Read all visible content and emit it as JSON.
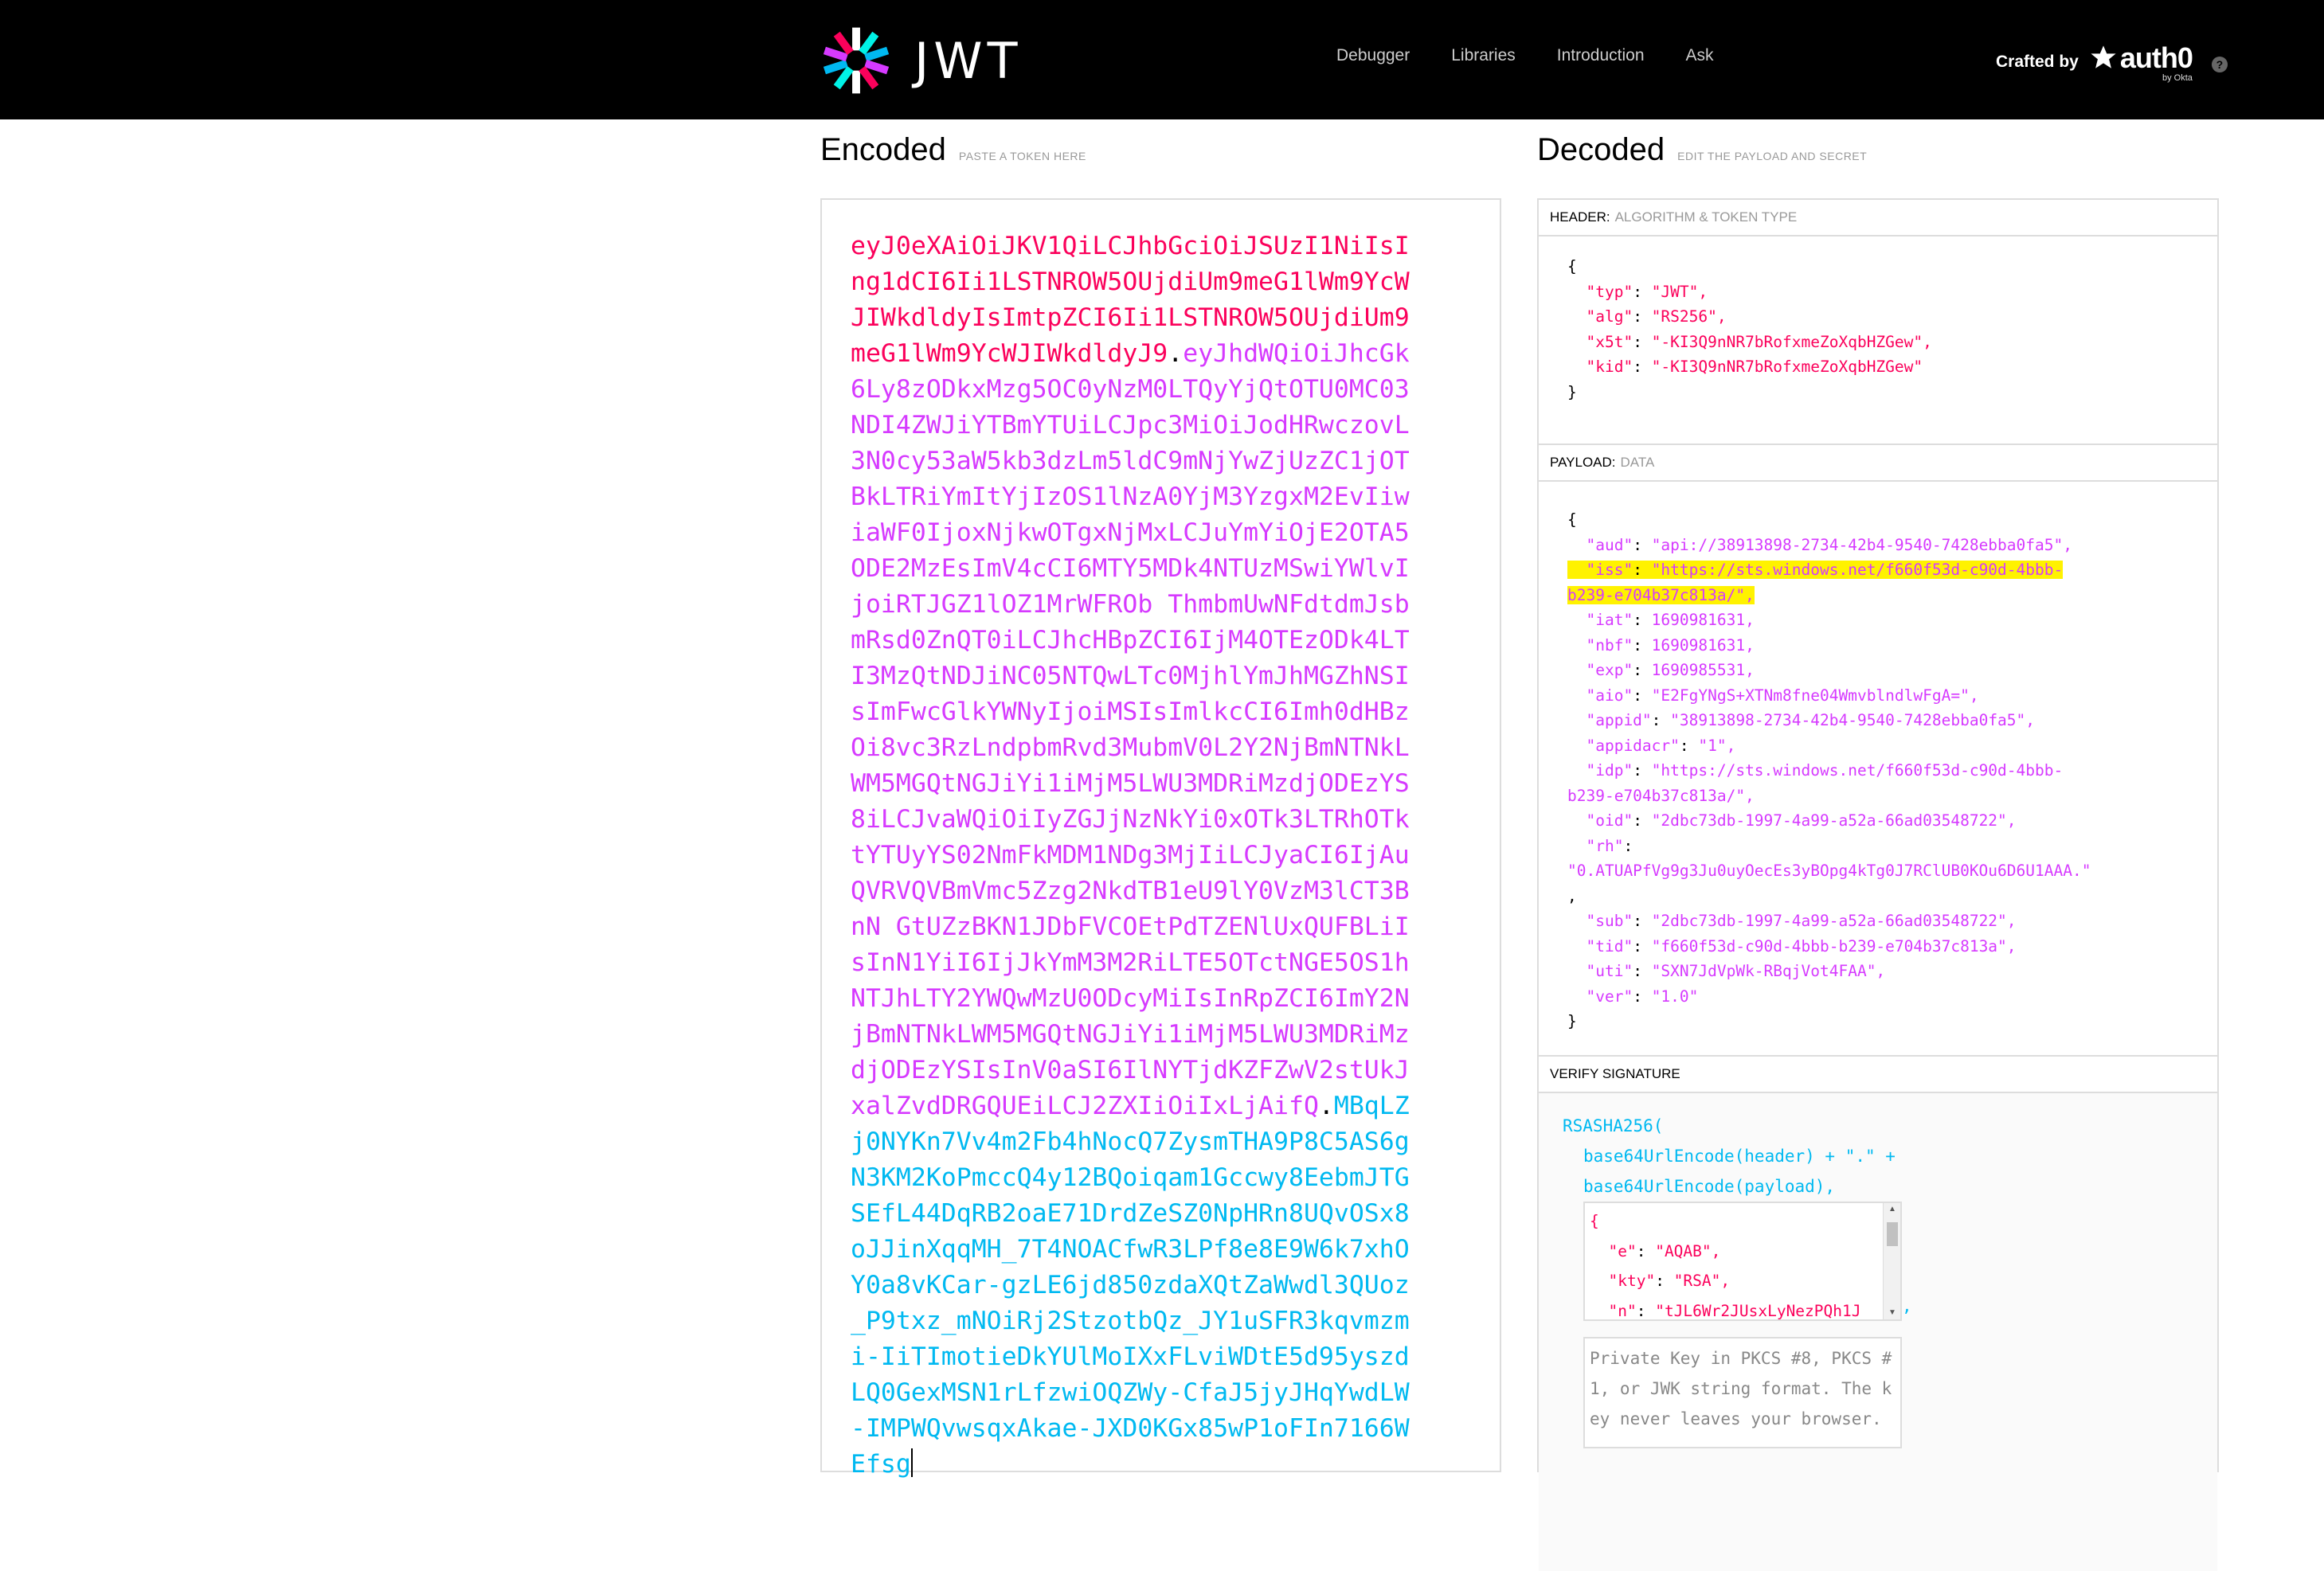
{
  "header": {
    "logo_text": "JWT",
    "nav": [
      "Debugger",
      "Libraries",
      "Introduction",
      "Ask"
    ],
    "crafted_by": "Crafted by",
    "auth0_name": "auth0",
    "auth0_by": "by Okta",
    "help": "?"
  },
  "encoded": {
    "title": "Encoded",
    "hint": "PASTE A TOKEN HERE",
    "token_header": "eyJ0eXAiOiJKV1QiLCJhbGciOiJSUzI1NiIsIng1dCI6Ii1LSTNROW5OUjdiUm9meG1lWm9YcWJIWkdldyIsImtpZCI6Ii1LSTNROW5OUjdiUm9meG1lWm9YcWJIWkdldyJ9",
    "token_payload": "eyJhdWQiOiJhcGk6Ly8zODkxMzg5OC0yNzM0LTQyYjQtOTU0MC03NDI4ZWJiYTBmYTUiLCJpc3MiOiJodHRwczovL3N0cy53aW5kb3dzLm5ldC9mNjYwZjUzZC1jOTBkLTRiYmItYjIzOS1lNzA0YjM3YzgxM2EvIiwiaWF0IjoxNjkwOTgxNjMxLCJuYmYiOjE2OTA5ODE2MzEsImV4cCI6MTY5MDk4NTUzMSwiYWlvIjoiRTJGZ1lOZ1MrWFROb ThmbmUwNFdtdmJsbmRsd0ZnQT0iLCJhcHBpZCI6IjM4OTEzODk4LTI3MzQtNDJiNC05NTQwLTc0MjhlYmJhMGZhNSIsImFwcGlkYWNyIjoiMSIsImlkcCI6Imh0dHBzOi8vc3RzLndpbmRvd3MubmV0L2Y2NjBmNTNkLWM5MGQtNGJiYi1iMjM5LWU3MDRiMzdjODEzYS8iLCJvaWQiOiIyZGJjNzNkYi0xOTk3LTRhOTktYTUyYS02NmFkMDM1NDg3MjIiLCJyaCI6IjAuQVRVQVBmVmc5Zzg2NkdTB1eU9lY0VzM3lCT3BnN GtUZzBKN1JDbFVCOEtPdTZENlUxQUFBLiIsInN1YiI6IjJkYmM3M2RiLTE5OTctNGE5OS1hNTJhLTY2YWQwMzU0ODcyMiIsInRpZCI6ImY2NjBmNTNkLWM5MGQtNGJiYi1iMjM5LWU3MDRiMzdjODEzYSIsInV0aSI6IlNYTjdKZFZwV2stUkJxalZvdDRGQUEiLCJ2ZXIiOiIxLjAifQ",
    "token_signature": "MBqLZj0NYKn7Vv4m2Fb4hNocQ7ZysmTHA9P8C5AS6gN3KM2KoPmccQ4y12BQoiqam1Gccwy8EebmJTGSEfL44DqRB2oaE71DrdZeSZ0NpHRn8UQvOSx8oJJinXqqMH_7T4NOACfwR3LPf8e8E9W6k7xhOY0a8vKCar-gzLE6jd850zdaXQtZaWwdl3QUoz_P9txz_mNOiRj2StzotbQz_JY1uSFR3kqvmzmi-IiTImotieDkYUlMoIXxFLviWDtE5d95yszdLQ0GexMSN1rLfzwiOQZWy-CfaJ5jyJHqYwdLW-IMPWQvwsqxAkae-JXD0KGx85wP1oFIn7166WEfsg",
    "dot": "."
  },
  "decoded": {
    "title": "Decoded",
    "hint": "EDIT THE PAYLOAD AND SECRET",
    "header_section": {
      "label": "HEADER:",
      "sublabel": "ALGORITHM & TOKEN TYPE",
      "lines": [
        {
          "key": "\"typ\"",
          "value": "\"JWT\","
        },
        {
          "key": "\"alg\"",
          "value": "\"RS256\","
        },
        {
          "key": "\"x5t\"",
          "value": "\"-KI3Q9nNR7bRofxmeZoXqbHZGew\","
        },
        {
          "key": "\"kid\"",
          "value": "\"-KI3Q9nNR7bRofxmeZoXqbHZGew\""
        }
      ]
    },
    "payload_section": {
      "label": "PAYLOAD:",
      "sublabel": "DATA",
      "lines": [
        {
          "key": "\"aud\"",
          "value": "\"api://38913898-2734-42b4-9540-7428ebba0fa5\","
        },
        {
          "key": "\"iss\"",
          "value": "\"https://sts.windows.net/f660f53d-c90d-4bbb-",
          "value2": "b239-e704b37c813a/\",",
          "highlight": true
        },
        {
          "key": "\"iat\"",
          "value": "1690981631,"
        },
        {
          "key": "\"nbf\"",
          "value": "1690981631,"
        },
        {
          "key": "\"exp\"",
          "value": "1690985531,"
        },
        {
          "key": "\"aio\"",
          "value": "\"E2FgYNgS+XTNm8fne04WmvblndlwFgA=\","
        },
        {
          "key": "\"appid\"",
          "value": "\"38913898-2734-42b4-9540-7428ebba0fa5\","
        },
        {
          "key": "\"appidacr\"",
          "value": "\"1\","
        },
        {
          "key": "\"idp\"",
          "value": "\"https://sts.windows.net/f660f53d-c90d-4bbb-",
          "value2": "b239-e704b37c813a/\","
        },
        {
          "key": "\"oid\"",
          "value": "\"2dbc73db-1997-4a99-a52a-66ad03548722\","
        },
        {
          "key": "\"rh\"",
          "value": "",
          "value2": "\"0.ATUAPfVg9g3Ju0uyOecEs3yBOpg4kTg0J7RClUB0KOu6D6U1AAA.\"",
          "value3": ","
        },
        {
          "key": "\"sub\"",
          "value": "\"2dbc73db-1997-4a99-a52a-66ad03548722\","
        },
        {
          "key": "\"tid\"",
          "value": "\"f660f53d-c90d-4bbb-b239-e704b37c813a\","
        },
        {
          "key": "\"uti\"",
          "value": "\"SXN7JdVpWk-RBqjVot4FAA\","
        },
        {
          "key": "\"ver\"",
          "value": "\"1.0\""
        }
      ]
    },
    "verify_section": {
      "label": "VERIFY SIGNATURE",
      "line1": "RSASHA256(",
      "line2": "base64UrlEncode(header) + \".\" +",
      "line3": "base64UrlEncode(payload),",
      "public_key_lines": [
        "{",
        "  \"e\": \"AQAB\",",
        "  \"kty\": \"RSA\",",
        "  \"n\": \"tJL6Wr2JUsxLyNezPQh1J"
      ],
      "comma": ",",
      "private_key_placeholder": "Private Key in PKCS #8, PKCS #1, or JWK string format. The key never leaves your browser."
    }
  },
  "colors": {
    "header_red": "#fb015b",
    "payload_purple": "#d63aff",
    "signature_blue": "#00b9f1",
    "highlight_yellow": "#fff200"
  }
}
